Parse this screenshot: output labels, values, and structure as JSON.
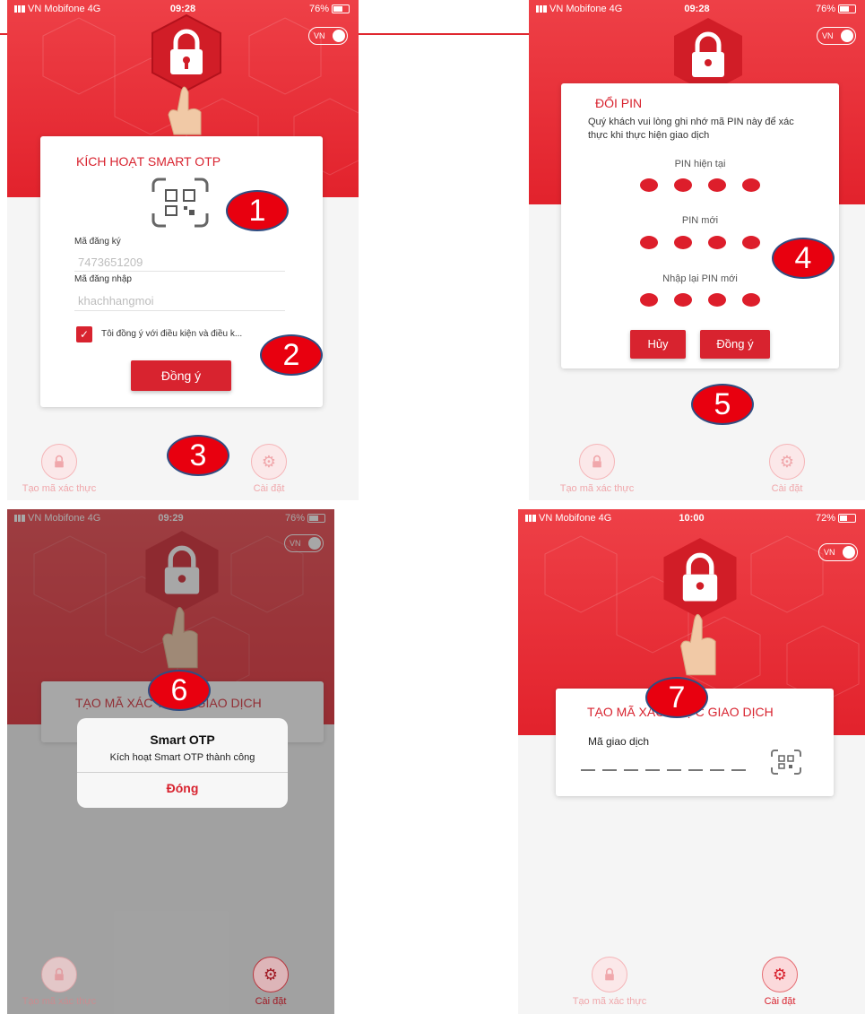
{
  "status_bar": {
    "p1": {
      "carrier": "VN Mobifone",
      "network": "4G",
      "time": "09:28",
      "battery": "76%"
    },
    "p2": {
      "carrier": "VN Mobifone",
      "network": "4G",
      "time": "09:28",
      "battery": "76%"
    },
    "p3": {
      "carrier": "VN Mobifone",
      "network": "4G",
      "time": "09:29",
      "battery": "76%"
    },
    "p4": {
      "carrier": "VN Mobifone",
      "network": "4G",
      "time": "10:00",
      "battery": "72%"
    }
  },
  "language_toggle": "VN",
  "screen1": {
    "title": "KÍCH HOẠT SMART OTP",
    "reg_label": "Mã đăng ký",
    "reg_value": "7473651209",
    "login_label": "Mã đăng nhập",
    "login_value": "khachhangmoi",
    "terms": "Tôi đồng ý với điều kiện và điều k...",
    "terms_checked": true,
    "agree_button": "Đồng ý"
  },
  "screen2": {
    "title": "ĐỔI PIN",
    "description": "Quý khách vui lòng ghi nhớ mã PIN này để xác thực khi thực hiện giao dịch",
    "current_pin_label": "PIN hiện tại",
    "new_pin_label": "PIN mới",
    "confirm_pin_label": "Nhập lại PIN mới",
    "cancel_button": "Hủy",
    "agree_button": "Đồng ý"
  },
  "screen3": {
    "card_title": "TẠO MÃ XÁC THỰC GIAO DỊCH",
    "alert_title": "Smart OTP",
    "alert_message": "Kích hoạt Smart OTP thành công",
    "alert_close": "Đóng"
  },
  "screen4": {
    "card_title": "TẠO MÃ XÁC THỰC GIAO DỊCH",
    "transaction_label": "Mã giao dịch"
  },
  "nav": {
    "create_code": "Tạo mã xác thực",
    "settings": "Cài đặt"
  },
  "step_badges": [
    "1",
    "2",
    "3",
    "4",
    "5",
    "6",
    "7"
  ],
  "colors": {
    "brand_red": "#e2222c",
    "badge_red": "#e8000f",
    "badge_border": "#2f4d82"
  }
}
